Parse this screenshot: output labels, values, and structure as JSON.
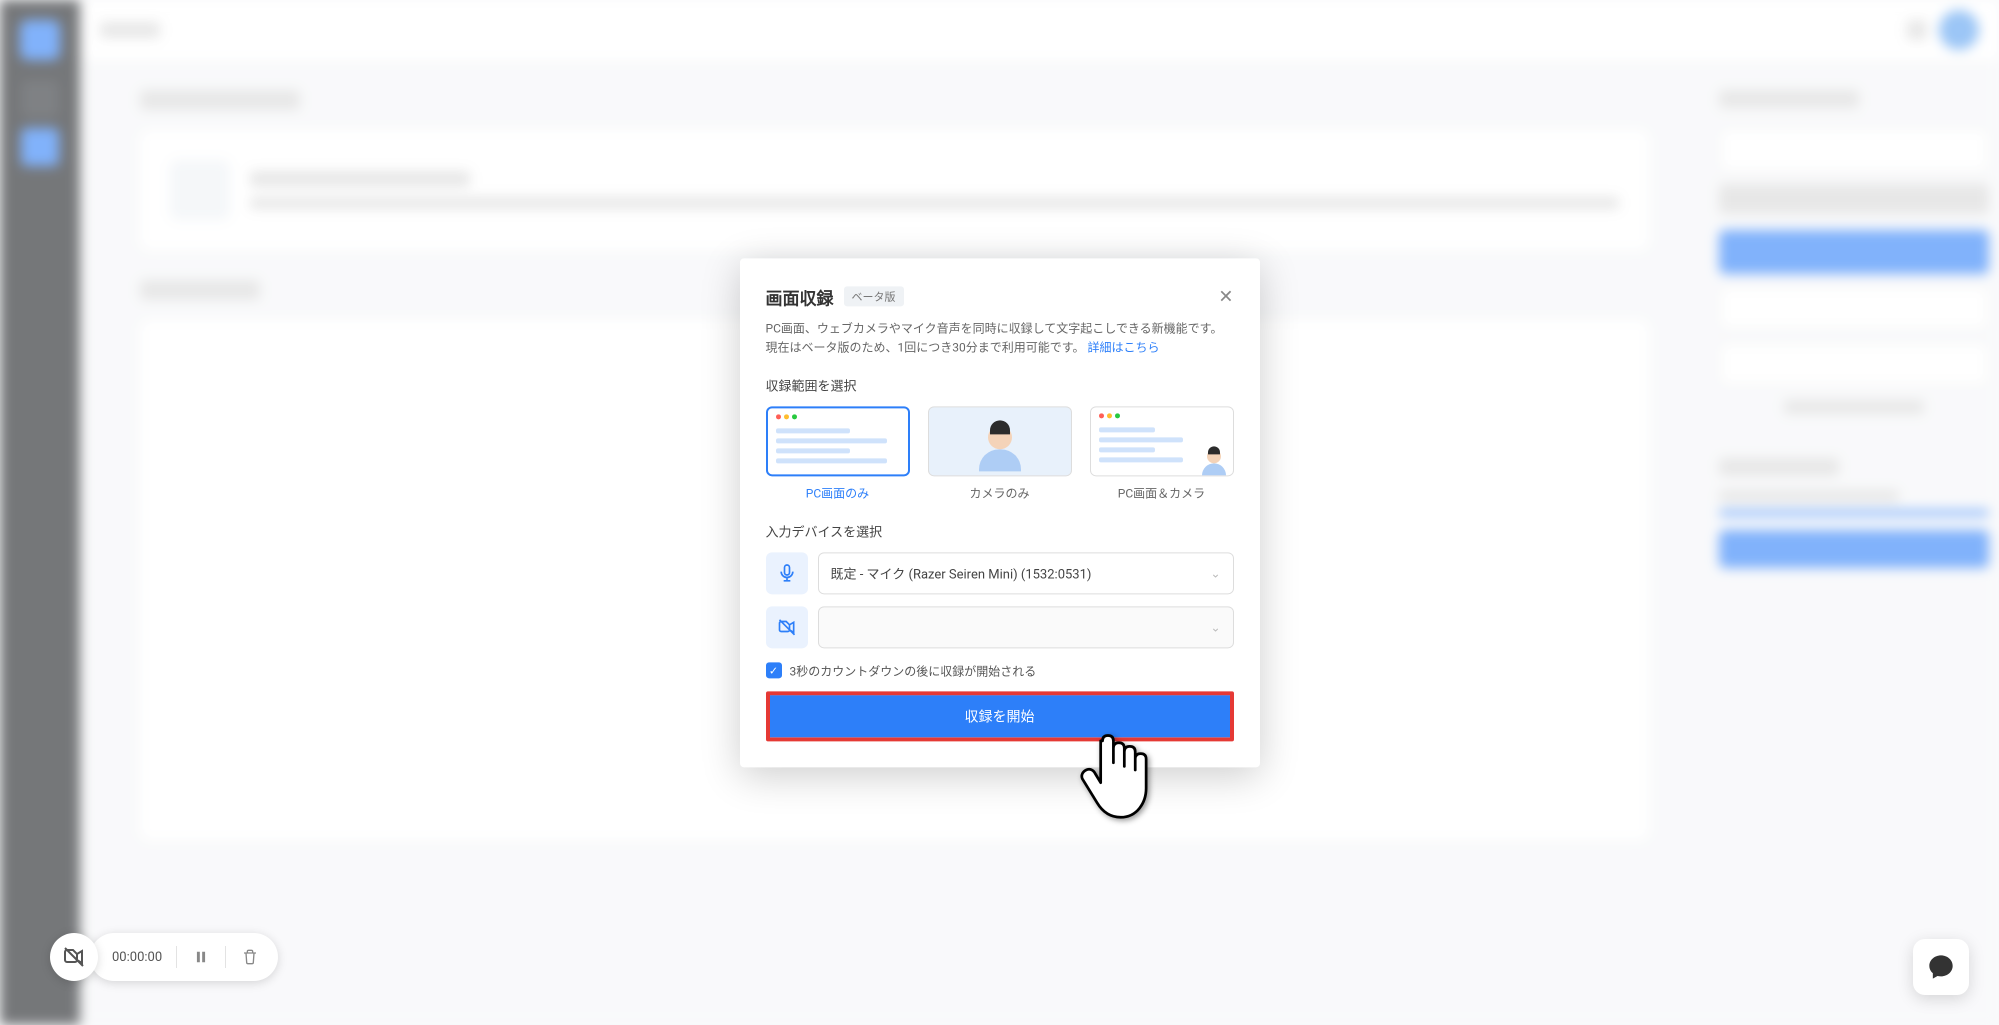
{
  "modal": {
    "title": "画面収録",
    "beta": "ベータ版",
    "description": "PC画面、ウェブカメラやマイク音声を同時に収録して文字起こしできる新機能です。現在はベータ版のため、1回につき30分まで利用可能です。",
    "details_link": "詳細はこちら",
    "range_label": "収録範囲を選択",
    "options": [
      {
        "label": "PC画面のみ",
        "selected": true
      },
      {
        "label": "カメラのみ",
        "selected": false
      },
      {
        "label": "PC画面＆カメラ",
        "selected": false
      }
    ],
    "device_label": "入力デバイスを選択",
    "mic_value": "既定 - マイク (Razer Seiren Mini) (1532:0531)",
    "camera_value": "",
    "checkbox_label": "3秒のカウントダウンの後に収録が開始される",
    "start_button": "収録を開始"
  },
  "recording": {
    "time": "00:00:00"
  }
}
